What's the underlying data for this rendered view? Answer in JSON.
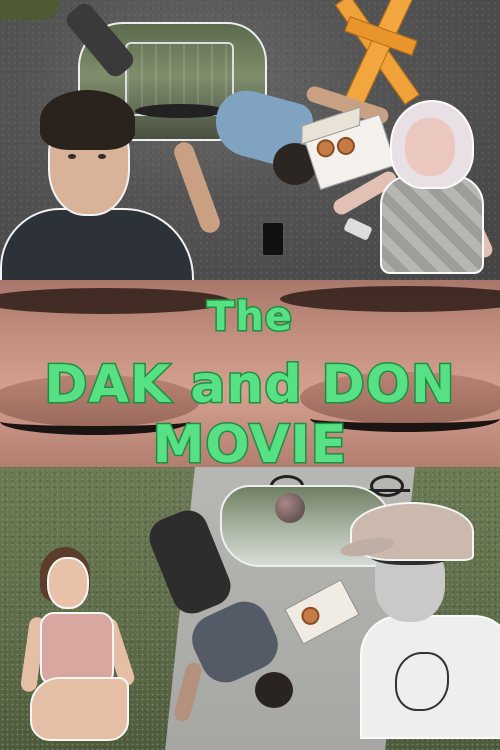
{
  "poster": {
    "title_line1": "The",
    "title_line2": "DAK and DON MOVIE",
    "title_color": "#58e084",
    "title_outline_color": "#1d8f42"
  },
  "panels": [
    {
      "name": "top-collage",
      "description_icons": [
        "trampoline",
        "sawhorse",
        "donut-box",
        "phone"
      ]
    },
    {
      "name": "eyes-title"
    },
    {
      "name": "bottom-collage",
      "description_icons": [
        "bicycle",
        "donut-box"
      ]
    }
  ]
}
